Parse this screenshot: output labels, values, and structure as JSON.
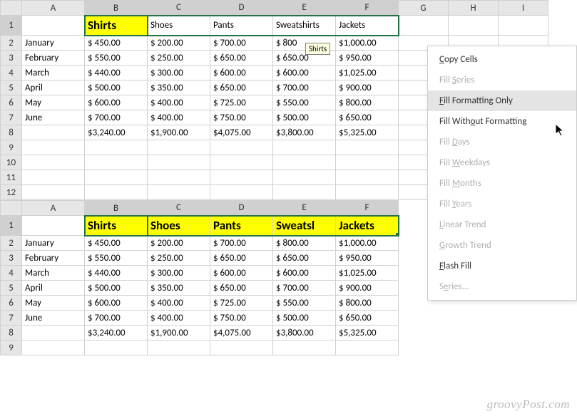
{
  "columns": [
    "A",
    "B",
    "C",
    "D",
    "E",
    "F",
    "G",
    "H",
    "I"
  ],
  "columns2": [
    "A",
    "B",
    "C",
    "D",
    "E",
    "F"
  ],
  "topGrid": {
    "headerRow": {
      "B": "Shirts",
      "C": "Shoes",
      "D": "Pants",
      "E": "Sweatshirts",
      "F": "Jackets"
    },
    "rows": [
      {
        "n": "2",
        "label": "January",
        "B": "$   450.00",
        "C": "$   200.00",
        "D": "$   700.00",
        "E": "$   800",
        "F": "$1,000.00"
      },
      {
        "n": "3",
        "label": "February",
        "B": "$   550.00",
        "C": "$   250.00",
        "D": "$   650.00",
        "E": "$   650.00",
        "F": "$   950.00"
      },
      {
        "n": "4",
        "label": "March",
        "B": "$   440.00",
        "C": "$   300.00",
        "D": "$   600.00",
        "E": "$   600.00",
        "F": "$1,025.00"
      },
      {
        "n": "5",
        "label": "April",
        "B": "$   500.00",
        "C": "$   350.00",
        "D": "$   650.00",
        "E": "$   700.00",
        "F": "$   900.00"
      },
      {
        "n": "6",
        "label": "May",
        "B": "$   600.00",
        "C": "$   400.00",
        "D": "$   725.00",
        "E": "$   550.00",
        "F": "$   800.00"
      },
      {
        "n": "7",
        "label": "June",
        "B": "$   700.00",
        "C": "$   400.00",
        "D": "$   750.00",
        "E": "$   500.00",
        "F": "$   650.00"
      },
      {
        "n": "8",
        "label": "",
        "B": "$3,240.00",
        "C": "$1,900.00",
        "D": "$4,075.00",
        "E": "$3,800.00",
        "F": "$5,325.00"
      }
    ],
    "emptyRows": [
      "9",
      "10",
      "11",
      "12"
    ],
    "tooltip": "Shirts"
  },
  "bottomGrid": {
    "headerRow": {
      "B": "Shirts",
      "C": "Shoes",
      "D": "Pants",
      "E": "Sweatsl",
      "F": "Jackets"
    },
    "rows": [
      {
        "n": "2",
        "label": "January",
        "B": "$   450.00",
        "C": "$   200.00",
        "D": "$   700.00",
        "E": "$   800.00",
        "F": "$1,000.00"
      },
      {
        "n": "3",
        "label": "February",
        "B": "$   550.00",
        "C": "$   250.00",
        "D": "$   650.00",
        "E": "$   650.00",
        "F": "$   950.00"
      },
      {
        "n": "4",
        "label": "March",
        "B": "$   440.00",
        "C": "$   300.00",
        "D": "$   600.00",
        "E": "$   600.00",
        "F": "$1,025.00"
      },
      {
        "n": "5",
        "label": "April",
        "B": "$   500.00",
        "C": "$   350.00",
        "D": "$   650.00",
        "E": "$   700.00",
        "F": "$   900.00"
      },
      {
        "n": "6",
        "label": "May",
        "B": "$   600.00",
        "C": "$   400.00",
        "D": "$   725.00",
        "E": "$   550.00",
        "F": "$   800.00"
      },
      {
        "n": "7",
        "label": "June",
        "B": "$   700.00",
        "C": "$   400.00",
        "D": "$   750.00",
        "E": "$   500.00",
        "F": "$   650.00"
      },
      {
        "n": "8",
        "label": "",
        "B": "$3,240.00",
        "C": "$1,900.00",
        "D": "$4,075.00",
        "E": "$3,800.00",
        "F": "$5,325.00"
      }
    ],
    "emptyRows": [
      "9"
    ]
  },
  "contextMenu": {
    "items": [
      {
        "label": "Copy Cells",
        "accel": "C",
        "disabled": false
      },
      {
        "label": "Fill Series",
        "accel": "S",
        "disabled": true
      },
      {
        "label": "Fill Formatting Only",
        "accel": "F",
        "disabled": false,
        "hover": true
      },
      {
        "label": "Fill Without Formatting",
        "accel": "O",
        "disabled": false
      },
      {
        "label": "Fill Days",
        "accel": "D",
        "disabled": true
      },
      {
        "label": "Fill Weekdays",
        "accel": "W",
        "disabled": true
      },
      {
        "label": "Fill Months",
        "accel": "M",
        "disabled": true
      },
      {
        "label": "Fill Years",
        "accel": "Y",
        "disabled": true
      },
      {
        "label": "Linear Trend",
        "accel": "L",
        "disabled": true
      },
      {
        "label": "Growth Trend",
        "accel": "G",
        "disabled": true
      },
      {
        "label": "Flash Fill",
        "accel": "F",
        "disabled": false
      },
      {
        "label": "Series...",
        "accel": "e",
        "disabled": true
      }
    ]
  },
  "watermark": "groovyPost.com"
}
